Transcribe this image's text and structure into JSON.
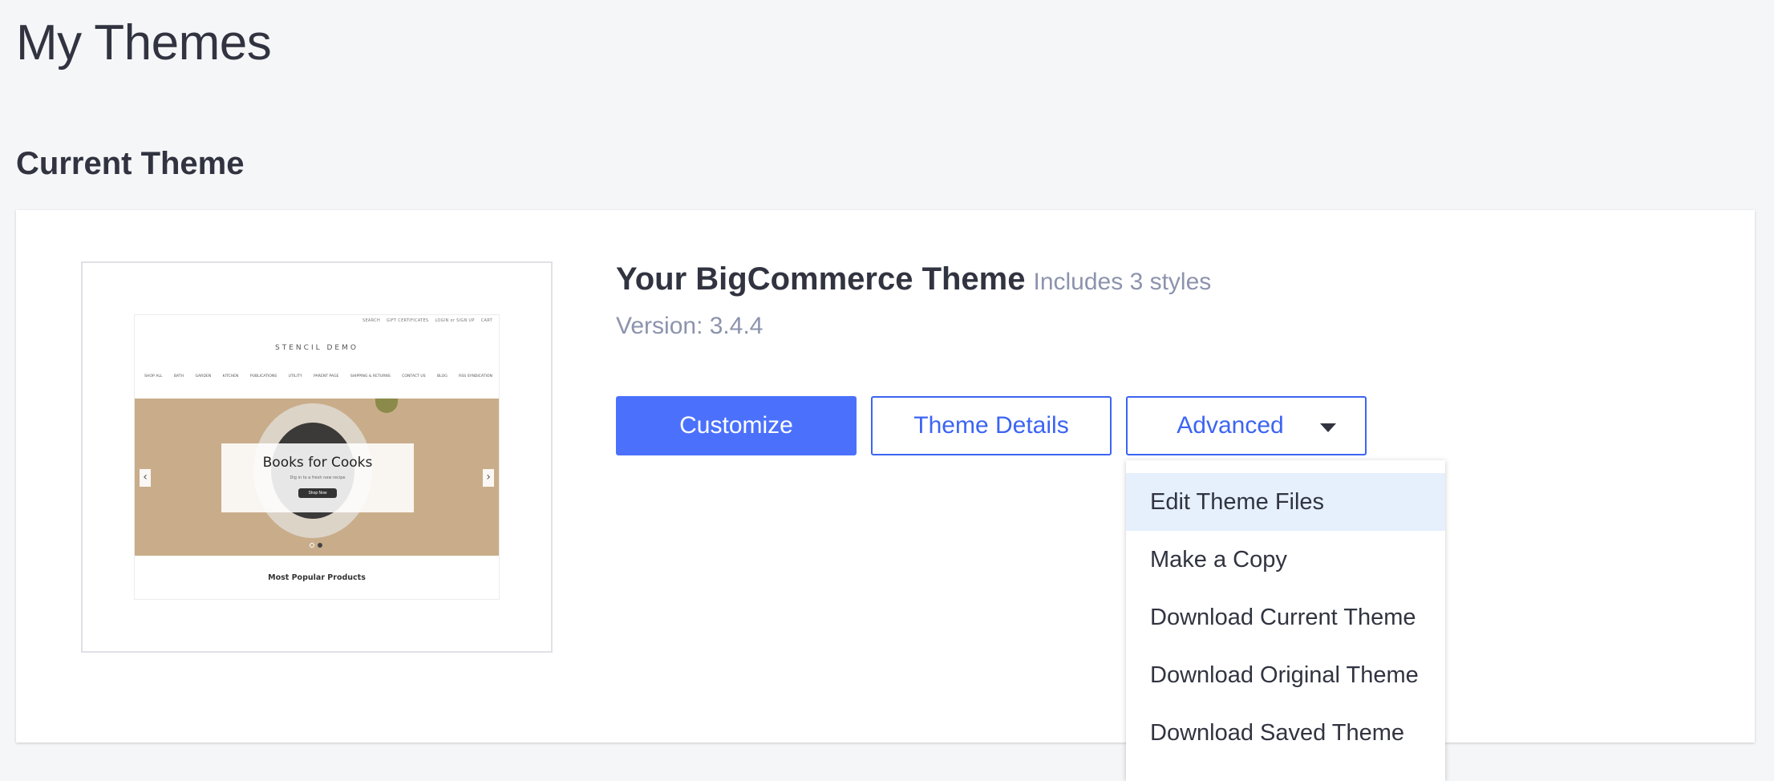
{
  "page": {
    "title": "My Themes"
  },
  "section": {
    "title": "Current Theme"
  },
  "theme": {
    "name": "Your BigCommerce Theme",
    "styles_note": "Includes 3 styles",
    "version": "Version: 3.4.4"
  },
  "preview": {
    "top_links": [
      "SEARCH",
      "GIFT CERTIFICATES",
      "LOGIN or SIGN UP",
      "CART"
    ],
    "logo": "STENCIL DEMO",
    "nav": [
      "SHOP ALL",
      "BATH",
      "GARDEN",
      "KITCHEN",
      "PUBLICATIONS",
      "UTILITY",
      "PARENT PAGE",
      "SHIPPING & RETURNS",
      "CONTACT US",
      "BLOG",
      "RSS SYNDICATION"
    ],
    "hero_heading": "Books for Cooks",
    "hero_subtext": "Dig in to a fresh new recipe",
    "hero_button": "Shop Now",
    "products_heading": "Most Popular Products"
  },
  "buttons": {
    "customize": "Customize",
    "details": "Theme Details",
    "advanced": "Advanced"
  },
  "advanced_menu": {
    "items": [
      {
        "label": "Edit Theme Files",
        "highlighted": true
      },
      {
        "label": "Make a Copy",
        "highlighted": false
      },
      {
        "label": "Download Current Theme",
        "highlighted": false
      },
      {
        "label": "Download Original Theme",
        "highlighted": false
      },
      {
        "label": "Download Saved Theme",
        "highlighted": false
      }
    ]
  },
  "colors": {
    "primary": "#4b71fc",
    "link": "#3c64f4",
    "text": "#313440",
    "muted": "#8c93ad",
    "menu_highlight": "#e5f0fc",
    "background": "#f5f6f8"
  },
  "icons": {
    "advanced_caret": "caret-down-icon",
    "slider_prev": "chevron-left-icon",
    "slider_next": "chevron-right-icon"
  }
}
